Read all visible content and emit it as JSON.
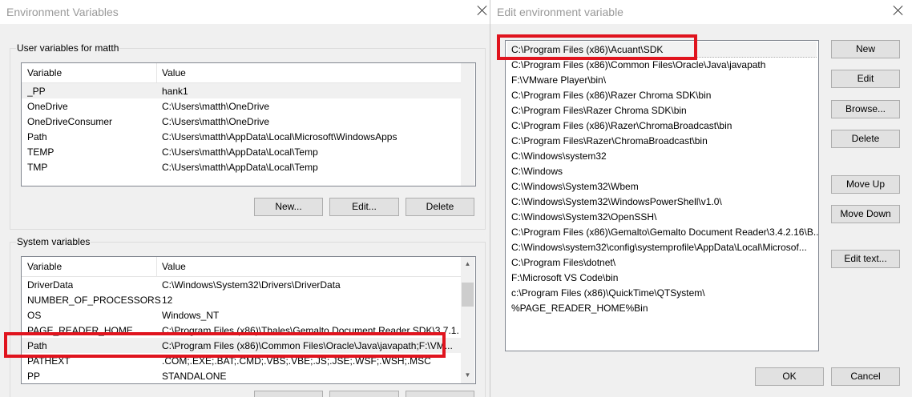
{
  "env_window": {
    "title": "Environment Variables",
    "user_group_label": "User variables for matth",
    "system_group_label": "System variables",
    "columns": {
      "variable": "Variable",
      "value": "Value"
    },
    "user_vars": [
      {
        "name": "_PP",
        "value": "hank1"
      },
      {
        "name": "OneDrive",
        "value": "C:\\Users\\matth\\OneDrive"
      },
      {
        "name": "OneDriveConsumer",
        "value": "C:\\Users\\matth\\OneDrive"
      },
      {
        "name": "Path",
        "value": "C:\\Users\\matth\\AppData\\Local\\Microsoft\\WindowsApps"
      },
      {
        "name": "TEMP",
        "value": "C:\\Users\\matth\\AppData\\Local\\Temp"
      },
      {
        "name": "TMP",
        "value": "C:\\Users\\matth\\AppData\\Local\\Temp"
      }
    ],
    "user_buttons": {
      "new": "New...",
      "edit": "Edit...",
      "delete": "Delete"
    },
    "system_vars": [
      {
        "name": "DriverData",
        "value": "C:\\Windows\\System32\\Drivers\\DriverData"
      },
      {
        "name": "NUMBER_OF_PROCESSORS",
        "value": "12"
      },
      {
        "name": "OS",
        "value": "Windows_NT"
      },
      {
        "name": "PAGE_READER_HOME",
        "value": "C:\\Program Files (x86)\\Thales\\Gemalto Document Reader SDK\\3.7.1..."
      },
      {
        "name": "Path",
        "value": "C:\\Program Files (x86)\\Common Files\\Oracle\\Java\\javapath;F:\\VM..."
      },
      {
        "name": "PATHEXT",
        "value": ".COM;.EXE;.BAT;.CMD;.VBS;.VBE;.JS;.JSE;.WSF;.WSH;.MSC"
      },
      {
        "name": "PP",
        "value": "STANDALONE"
      }
    ]
  },
  "edit_window": {
    "title": "Edit environment variable",
    "entries": [
      "C:\\Program Files (x86)\\Acuant\\SDK",
      "C:\\Program Files (x86)\\Common Files\\Oracle\\Java\\javapath",
      "F:\\VMware Player\\bin\\",
      "C:\\Program Files (x86)\\Razer Chroma SDK\\bin",
      "C:\\Program Files\\Razer Chroma SDK\\bin",
      "C:\\Program Files (x86)\\Razer\\ChromaBroadcast\\bin",
      "C:\\Program Files\\Razer\\ChromaBroadcast\\bin",
      "C:\\Windows\\system32",
      "C:\\Windows",
      "C:\\Windows\\System32\\Wbem",
      "C:\\Windows\\System32\\WindowsPowerShell\\v1.0\\",
      "C:\\Windows\\System32\\OpenSSH\\",
      "C:\\Program Files (x86)\\Gemalto\\Gemalto Document Reader\\3.4.2.16\\B...",
      "C:\\Windows\\system32\\config\\systemprofile\\AppData\\Local\\Microsof...",
      "C:\\Program Files\\dotnet\\",
      "F:\\Microsoft VS Code\\bin",
      "c:\\Program Files (x86)\\QuickTime\\QTSystem\\",
      "%PAGE_READER_HOME%Bin"
    ],
    "buttons": {
      "new": "New",
      "edit": "Edit",
      "browse": "Browse...",
      "delete": "Delete",
      "move_up": "Move Up",
      "move_down": "Move Down",
      "edit_text": "Edit text...",
      "ok": "OK",
      "cancel": "Cancel"
    }
  },
  "highlight_color": "#e0141e"
}
